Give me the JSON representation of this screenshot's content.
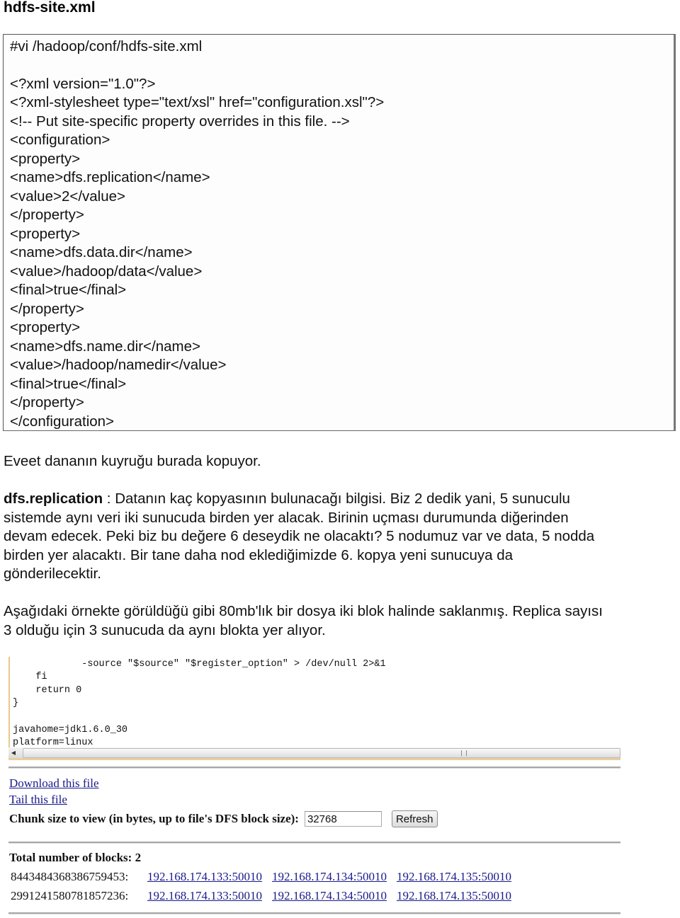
{
  "document": {
    "title": "hdfs-site.xml",
    "code_lines": [
      "#vi /hadoop/conf/hdfs-site.xml",
      "",
      "<?xml version=\"1.0\"?>",
      "<?xml-stylesheet type=\"text/xsl\" href=\"configuration.xsl\"?>",
      "<!-- Put site-specific property overrides in this file. -->",
      "<configuration>",
      "<property>",
      "<name>dfs.replication</name>",
      "<value>2</value>",
      "</property>",
      "<property>",
      "<name>dfs.data.dir</name>",
      "<value>/hadoop/data</value>",
      "<final>true</final>",
      "</property>",
      "<property>",
      "<name>dfs.name.dir</name>",
      "<value>/hadoop/namedir</value>",
      "<final>true</final>",
      "</property>",
      "</configuration>"
    ],
    "para1": "Eveet dananın kuyruğu burada kopuyor.",
    "para2_bold": "dfs.replication",
    "para2_lines": [
      " : Datanın kaç kopyasının bulunacağı bilgisi. Biz 2 dedik yani, 5 sunuculu",
      "sistemde aynı veri iki sunucuda birden yer alacak. Birinin uçması durumunda diğerinden",
      "devam edecek. Peki biz bu değere 6 deseydik ne olacaktı? 5 nodumuz var ve data, 5 nodda",
      "birden yer alacaktı. Bir tane daha nod eklediğimizde 6. kopya yeni sunucuya da",
      "gönderilecektir."
    ],
    "para3_lines": [
      "Aşağıdaki örnekte görüldüğü gibi 80mb'lık bir dosya iki blok halinde saklanmış. Replica sayısı",
      "3 olduğu için 3 sunucuda da aynı blokta yer alıyor."
    ]
  },
  "screenshot": {
    "code_lines": [
      "            -source \"$source\" \"$register_option\" > /dev/null 2>&1",
      "    fi",
      "    return 0",
      "}",
      "",
      "javahome=jdk1.6.0_30",
      "platform=linux"
    ],
    "scroll_left_icon": "scroll-left-arrow-icon",
    "links": {
      "download": "Download this file",
      "tail": "Tail this file"
    },
    "chunk": {
      "label": "Chunk size to view (in bytes, up to file's DFS block size):",
      "value": "32768",
      "refresh_label": "Refresh"
    },
    "total_blocks_label": "Total number of blocks: 2",
    "blocks": [
      {
        "id": "8443484368386759453:",
        "datanodes": [
          "192.168.174.133:50010",
          "192.168.174.134:50010",
          "192.168.174.135:50010"
        ]
      },
      {
        "id": "2991241580781857236:",
        "datanodes": [
          "192.168.174.133:50010",
          "192.168.174.134:50010",
          "192.168.174.135:50010"
        ]
      }
    ]
  }
}
